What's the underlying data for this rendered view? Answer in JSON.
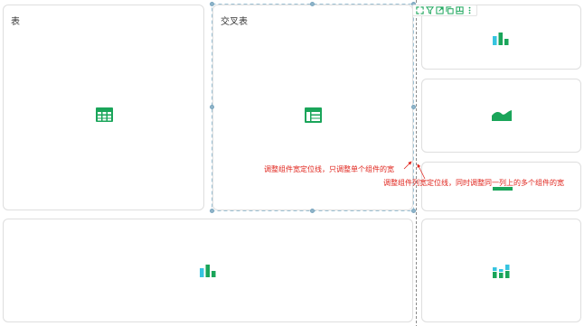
{
  "cards": {
    "table_title": "表",
    "crosstab_title": "交叉表"
  },
  "toolbar": {
    "buttons": [
      "expand-icon",
      "filter-icon",
      "export-icon",
      "copy-icon",
      "dashboard-icon",
      "more-icon"
    ]
  },
  "annotations": {
    "single": "调整组件宽定位线，只调整单个组件的宽",
    "column": "调整组件列宽定位线，同时调整同一列上的多个组件的宽"
  },
  "colors": {
    "icon_green": "#1aa55a",
    "icon_cyan": "#36c4e0",
    "selection_dash": "#9fc3d6",
    "annotation_red": "#e0241c"
  }
}
